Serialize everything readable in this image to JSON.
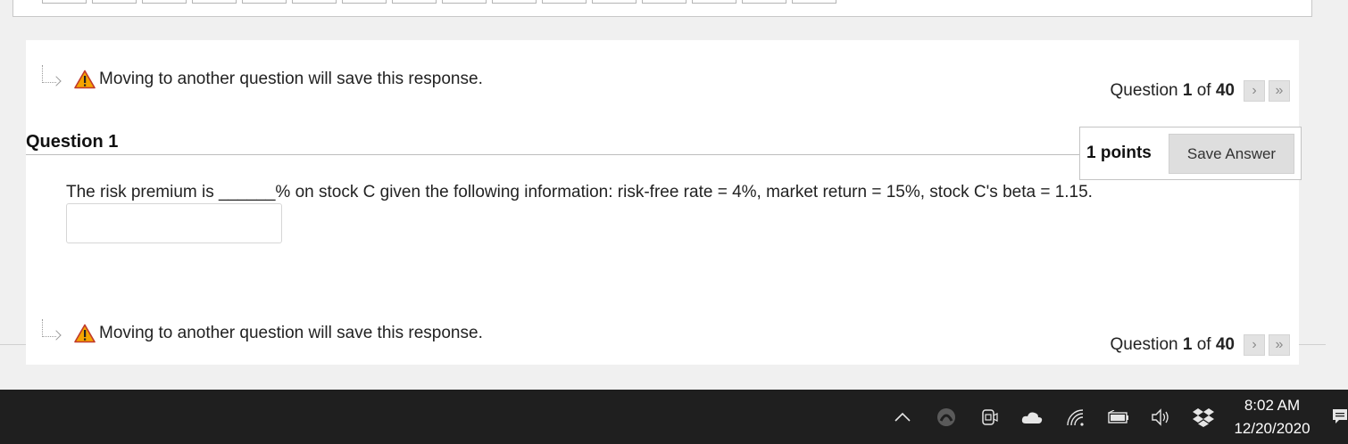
{
  "warning": {
    "text": "Moving to another question will save this response."
  },
  "question_nav": {
    "prefix": "Question",
    "current": "1",
    "of_label": "of",
    "total": "40"
  },
  "question": {
    "title": "Question 1",
    "points": "1 points",
    "save_label": "Save Answer",
    "text": "The risk premium is ______% on stock C given the following information: risk-free rate = 4%, market return = 15%, stock C's beta = 1.15.",
    "answer_value": ""
  },
  "taskbar": {
    "time": "8:02 AM",
    "date": "12/20/2020",
    "tray_icons": [
      "chevron-up-icon",
      "app-icon",
      "meet-now-icon",
      "onedrive-icon",
      "wifi-icon",
      "battery-icon",
      "volume-icon",
      "dropbox-icon"
    ]
  },
  "colors": {
    "warning_fill": "#f5a400",
    "warning_border": "#c0392b",
    "taskbar_bg": "#1f1f1f"
  }
}
